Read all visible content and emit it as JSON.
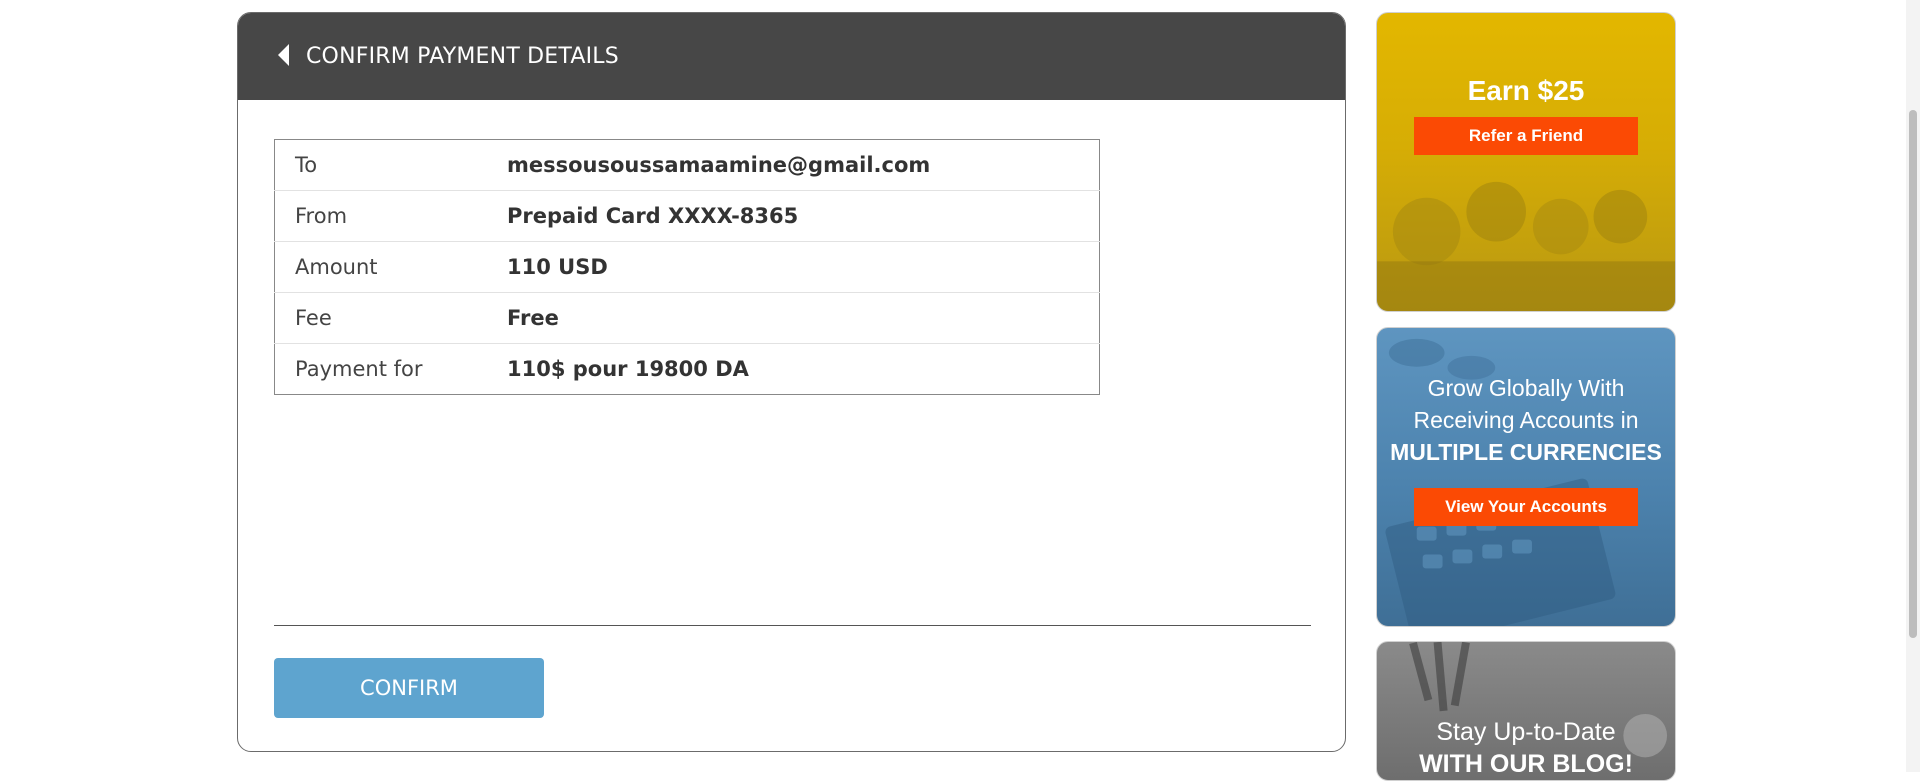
{
  "header": {
    "title": "CONFIRM PAYMENT DETAILS",
    "back_icon": "back-caret-icon"
  },
  "details": {
    "rows": [
      {
        "label": "To",
        "value": "messousoussamaamine@gmail.com"
      },
      {
        "label": "From",
        "value": "Prepaid Card XXXX-8365"
      },
      {
        "label": "Amount",
        "value": "110 USD"
      },
      {
        "label": "Fee",
        "value": "Free"
      },
      {
        "label": "Payment for",
        "value": "110$ pour 19800 DA"
      }
    ]
  },
  "actions": {
    "confirm_label": "CONFIRM"
  },
  "promos": {
    "refer": {
      "title": "Earn $25",
      "button": "Refer a Friend"
    },
    "accounts": {
      "line1": "Grow Globally With",
      "line2": "Receiving Accounts in",
      "line3": "MULTIPLE CURRENCIES",
      "button": "View Your Accounts"
    },
    "blog": {
      "line1": "Stay Up-to-Date",
      "line2": "WITH OUR BLOG!"
    }
  },
  "colors": {
    "header_bg": "#474747",
    "confirm_button": "#5ea4cf",
    "promo_orange": "#fb4a04",
    "promo_yellow": "#e3b700",
    "promo_blue": "#5e95c0"
  }
}
